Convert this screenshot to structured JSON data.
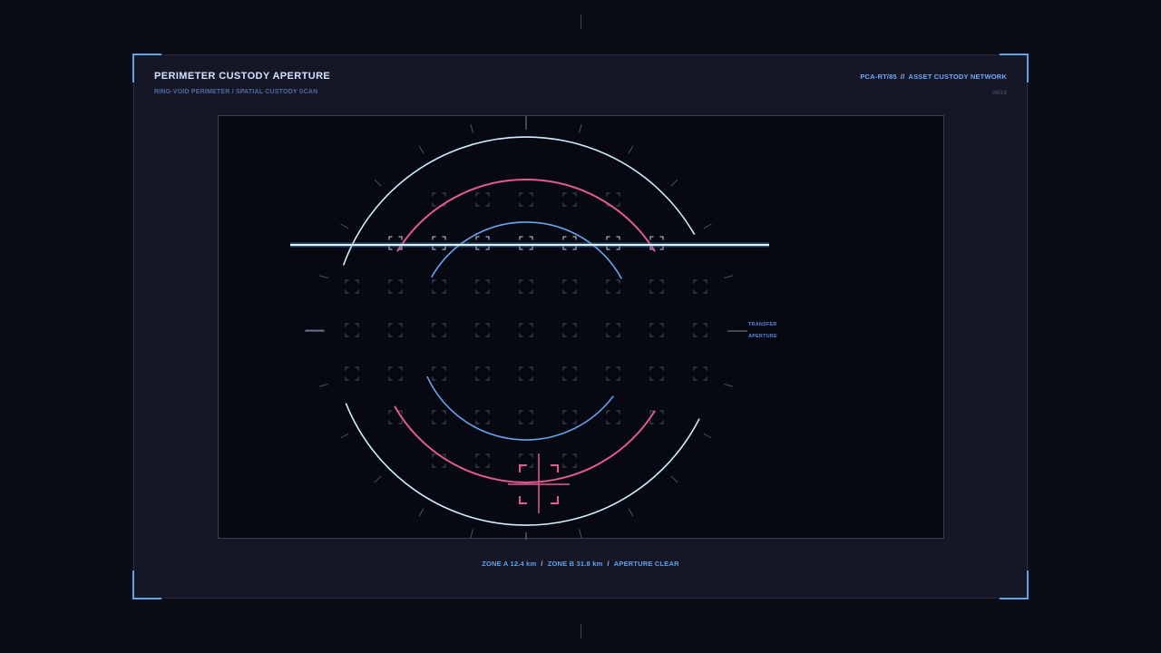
{
  "header": {
    "title": "PERIMETER CUSTODY APERTURE",
    "subtitle": "RING-VOID PERIMETER / SPATIAL CUSTODY SCAN",
    "code": "PCA-RT/85",
    "separator": "//",
    "network": "ASSET CUSTODY NETWORK",
    "page": "09/19"
  },
  "viewport": {
    "side_label_line1": "TRANSFER",
    "side_label_line2": "APERTURE",
    "rings": [
      {
        "name": "outer-ring",
        "color": "#cfeeff"
      },
      {
        "name": "middle-ring",
        "color": "#e35a94"
      },
      {
        "name": "inner-ring",
        "color": "#6aa5f0"
      }
    ],
    "scan_line_color": "#d8f0ff",
    "target_color": "#e35a94"
  },
  "footer": {
    "zone_a": "ZONE A 12.4 km",
    "zone_b": "ZONE B 31.8 km",
    "status": "APERTURE CLEAR",
    "separator": "/"
  },
  "colors": {
    "accent": "#5ea3e6",
    "background": "#0a0c16",
    "panel": "#151726"
  }
}
